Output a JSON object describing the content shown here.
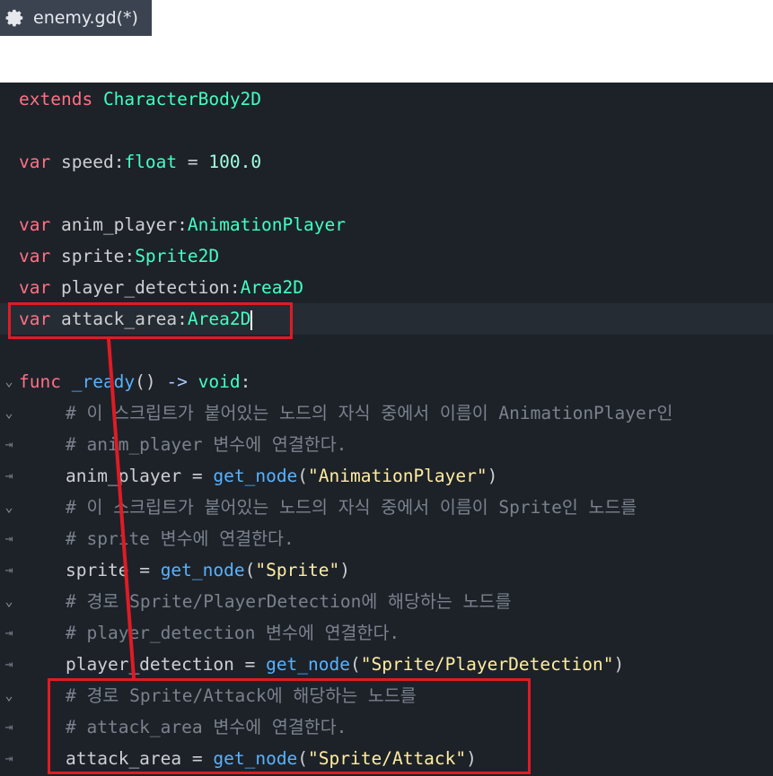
{
  "tab": {
    "title": "enemy.gd(*)",
    "icon": "gear-icon"
  },
  "lines": {
    "l1": {
      "kw": "extends",
      "type": "CharacterBody2D"
    },
    "l3": {
      "kw": "var",
      "name": "speed",
      "colon": ":",
      "type": "float",
      "eq": " = ",
      "value": "100.0"
    },
    "l5": {
      "kw": "var",
      "name": "anim_player",
      "colon": ":",
      "type": "AnimationPlayer"
    },
    "l6": {
      "kw": "var",
      "name": "sprite",
      "colon": ":",
      "type": "Sprite2D"
    },
    "l7": {
      "kw": "var",
      "name": "player_detection",
      "colon": ":",
      "type": "Area2D"
    },
    "l8": {
      "kw": "var",
      "name": "attack_area",
      "colon": ":",
      "type": "Area2D"
    },
    "l10": {
      "kw": "func",
      "name": "_ready",
      "params": "()",
      "arrow": " -> ",
      "ret": "void",
      "colon": ":"
    },
    "l11": {
      "comment": "# 이 스크립트가 붙어있는 노드의 자식 중에서 이름이 AnimationPlayer인"
    },
    "l12": {
      "comment": "# anim_player 변수에 연결한다."
    },
    "l13": {
      "name": "anim_player",
      "eq": " = ",
      "fn": "get_node",
      "open": "(",
      "str": "\"AnimationPlayer\"",
      "close": ")"
    },
    "l14": {
      "comment": "# 이 스크립트가 붙어있는 노드의 자식 중에서 이름이 Sprite인 노드를"
    },
    "l15": {
      "comment": "# sprite 변수에 연결한다."
    },
    "l16": {
      "name": "sprite",
      "eq": " = ",
      "fn": "get_node",
      "open": "(",
      "str": "\"Sprite\"",
      "close": ")"
    },
    "l17": {
      "comment": "# 경로 Sprite/PlayerDetection에 해당하는 노드를"
    },
    "l18": {
      "comment": "# player_detection 변수에 연결한다."
    },
    "l19": {
      "name": "player_detection",
      "eq": " = ",
      "fn": "get_node",
      "open": "(",
      "str": "\"Sprite/PlayerDetection\"",
      "close": ")"
    },
    "l20": {
      "comment": "# 경로 Sprite/Attack에 해당하는 노드를"
    },
    "l21": {
      "comment": "# attack_area 변수에 연결한다."
    },
    "l22": {
      "name": "attack_area",
      "eq": " = ",
      "fn": "get_node",
      "open": "(",
      "str": "\"Sprite/Attack\"",
      "close": ")"
    }
  },
  "gutter": {
    "fold": "⌄",
    "tab": "⇥"
  },
  "colors": {
    "keyword": "#ff7085",
    "type": "#42ffc2",
    "number": "#a1ffe0",
    "string": "#ffeda1",
    "function": "#57b3ff",
    "comment": "#7b828d",
    "annotation": "#e01b24",
    "editor_bg": "#1d2229"
  }
}
